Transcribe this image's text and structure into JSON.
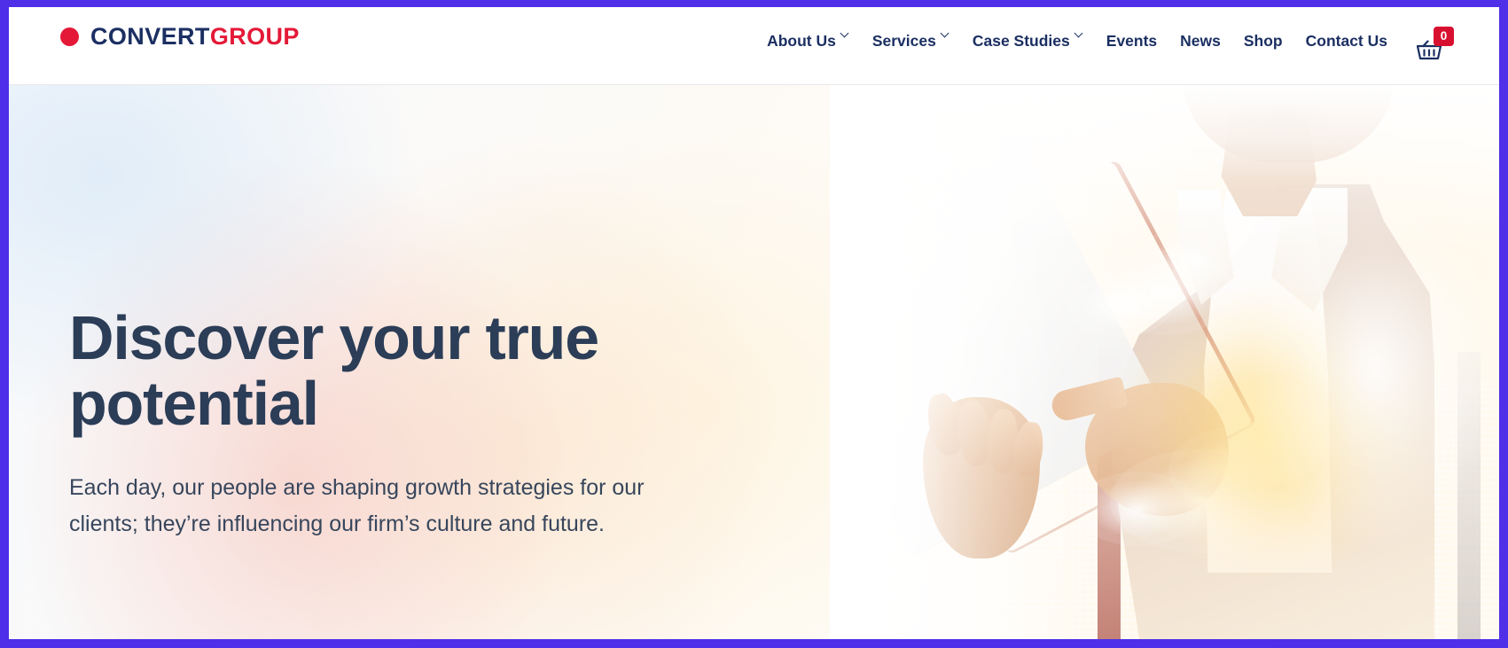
{
  "frame": {
    "border_color": "#4f2fe8"
  },
  "header": {
    "logo": {
      "name": "Convert Group",
      "part_one": "CONVERT",
      "part_two": "GROUP",
      "dot_color": "#e41937",
      "part_one_color": "#1b2f62",
      "part_two_color": "#e41937"
    },
    "nav": [
      {
        "label": "About Us",
        "has_dropdown": true,
        "icon": "chevron-down-icon"
      },
      {
        "label": "Services",
        "has_dropdown": true,
        "icon": "chevron-down-icon"
      },
      {
        "label": "Case Studies",
        "has_dropdown": true,
        "icon": "chevron-down-icon"
      },
      {
        "label": "Events",
        "has_dropdown": false,
        "icon": ""
      },
      {
        "label": "News",
        "has_dropdown": false,
        "icon": ""
      },
      {
        "label": "Shop",
        "has_dropdown": false,
        "icon": ""
      },
      {
        "label": "Contact Us",
        "has_dropdown": false,
        "icon": ""
      }
    ],
    "cart": {
      "icon": "shopping-basket-icon",
      "count": "0",
      "badge_color": "#d81030",
      "icon_color": "#1b2f62"
    }
  },
  "hero": {
    "title": "Discover your true potential",
    "subtitle": "Each day, our people are shaping growth strategies for our clients; they’re influencing our firm’s culture and future.",
    "title_color": "#2b3d57",
    "subtitle_color": "#37465c",
    "image_description": "Double exposure of a businessman in a light suit holding a tablet, overlaid with a sunlit city skyline and clouds"
  }
}
